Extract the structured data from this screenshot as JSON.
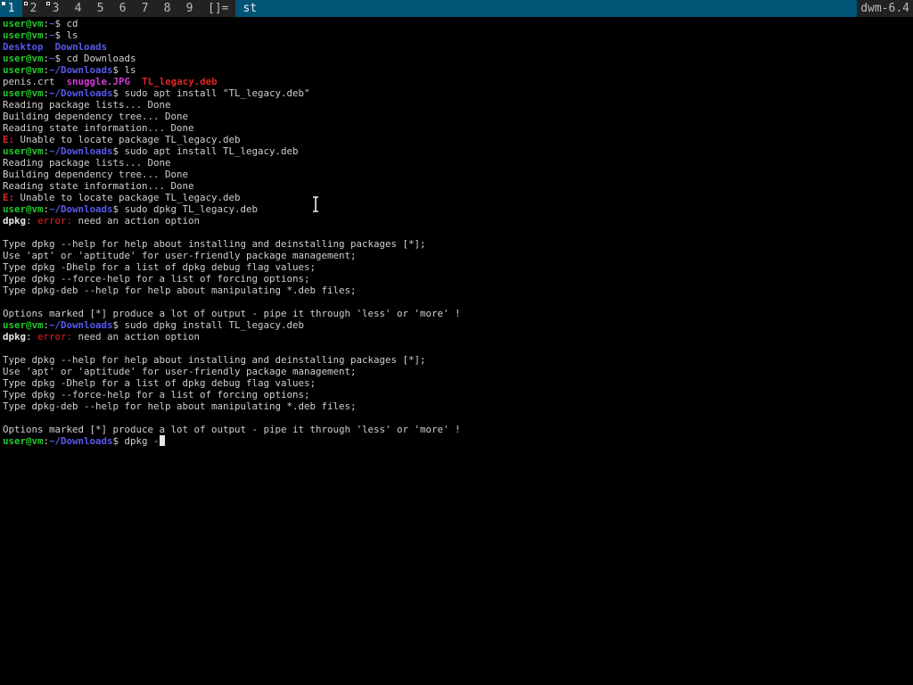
{
  "bar": {
    "tags": [
      "1",
      "2",
      "3",
      "4",
      "5",
      "6",
      "7",
      "8",
      "9"
    ],
    "selected_tag": "1",
    "layout_symbol": "[]=",
    "window_title": "st",
    "status_text": "dwm-6.4"
  },
  "terminal": {
    "prompt_user": "user@vm",
    "lines": [
      [
        {
          "t": "user@vm",
          "c": "u"
        },
        {
          "t": ":",
          "c": "w"
        },
        {
          "t": "~",
          "c": "p"
        },
        {
          "t": "$ cd",
          "c": "w"
        }
      ],
      [
        {
          "t": "user@vm",
          "c": "u"
        },
        {
          "t": ":",
          "c": "w"
        },
        {
          "t": "~",
          "c": "p"
        },
        {
          "t": "$ ls",
          "c": "w"
        }
      ],
      [
        {
          "t": "Desktop",
          "c": "dir"
        },
        {
          "t": "  ",
          "c": "w"
        },
        {
          "t": "Downloads",
          "c": "dir"
        }
      ],
      [
        {
          "t": "user@vm",
          "c": "u"
        },
        {
          "t": ":",
          "c": "w"
        },
        {
          "t": "~",
          "c": "p"
        },
        {
          "t": "$ cd Downloads",
          "c": "w"
        }
      ],
      [
        {
          "t": "user@vm",
          "c": "u"
        },
        {
          "t": ":",
          "c": "w"
        },
        {
          "t": "~/Downloads",
          "c": "p"
        },
        {
          "t": "$ ls",
          "c": "w"
        }
      ],
      [
        {
          "t": "penis.crt",
          "c": "w"
        },
        {
          "t": "  ",
          "c": "w"
        },
        {
          "t": "snuggle.JPG",
          "c": "img"
        },
        {
          "t": "  ",
          "c": "w"
        },
        {
          "t": "TL_legacy.deb",
          "c": "deb"
        }
      ],
      [
        {
          "t": "user@vm",
          "c": "u"
        },
        {
          "t": ":",
          "c": "w"
        },
        {
          "t": "~/Downloads",
          "c": "p"
        },
        {
          "t": "$ sudo apt install \"TL_legacy.deb\"",
          "c": "w"
        }
      ],
      [
        {
          "t": "Reading package lists... Done",
          "c": "w"
        }
      ],
      [
        {
          "t": "Building dependency tree... Done",
          "c": "w"
        }
      ],
      [
        {
          "t": "Reading state information... Done",
          "c": "w"
        }
      ],
      [
        {
          "t": "E:",
          "c": "err"
        },
        {
          "t": " Unable to locate package TL_legacy.deb",
          "c": "w"
        }
      ],
      [
        {
          "t": "user@vm",
          "c": "u"
        },
        {
          "t": ":",
          "c": "w"
        },
        {
          "t": "~/Downloads",
          "c": "p"
        },
        {
          "t": "$ sudo apt install TL_legacy.deb",
          "c": "w"
        }
      ],
      [
        {
          "t": "Reading package lists... Done",
          "c": "w"
        }
      ],
      [
        {
          "t": "Building dependency tree... Done",
          "c": "w"
        }
      ],
      [
        {
          "t": "Reading state information... Done",
          "c": "w"
        }
      ],
      [
        {
          "t": "E:",
          "c": "err"
        },
        {
          "t": " Unable to locate package TL_legacy.deb",
          "c": "w"
        }
      ],
      [
        {
          "t": "user@vm",
          "c": "u"
        },
        {
          "t": ":",
          "c": "w"
        },
        {
          "t": "~/Downloads",
          "c": "p"
        },
        {
          "t": "$ sudo dpkg TL_legacy.deb",
          "c": "w"
        }
      ],
      [
        {
          "t": "dpkg",
          "c": "bold"
        },
        {
          "t": ": ",
          "c": "w"
        },
        {
          "t": "error:",
          "c": "errtxt"
        },
        {
          "t": " need an action option",
          "c": "w"
        }
      ],
      [
        {
          "t": "",
          "c": "w"
        }
      ],
      [
        {
          "t": "Type dpkg --help for help about installing and deinstalling packages [*];",
          "c": "w"
        }
      ],
      [
        {
          "t": "Use 'apt' or 'aptitude' for user-friendly package management;",
          "c": "w"
        }
      ],
      [
        {
          "t": "Type dpkg -Dhelp for a list of dpkg debug flag values;",
          "c": "w"
        }
      ],
      [
        {
          "t": "Type dpkg --force-help for a list of forcing options;",
          "c": "w"
        }
      ],
      [
        {
          "t": "Type dpkg-deb --help for help about manipulating *.deb files;",
          "c": "w"
        }
      ],
      [
        {
          "t": "",
          "c": "w"
        }
      ],
      [
        {
          "t": "Options marked [*] produce a lot of output - pipe it through 'less' or 'more' !",
          "c": "w"
        }
      ],
      [
        {
          "t": "user@vm",
          "c": "u"
        },
        {
          "t": ":",
          "c": "w"
        },
        {
          "t": "~/Downloads",
          "c": "p"
        },
        {
          "t": "$ sudo dpkg install TL_legacy.deb",
          "c": "w"
        }
      ],
      [
        {
          "t": "dpkg",
          "c": "bold"
        },
        {
          "t": ": ",
          "c": "w"
        },
        {
          "t": "error:",
          "c": "errtxt"
        },
        {
          "t": " need an action option",
          "c": "w"
        }
      ],
      [
        {
          "t": "",
          "c": "w"
        }
      ],
      [
        {
          "t": "Type dpkg --help for help about installing and deinstalling packages [*];",
          "c": "w"
        }
      ],
      [
        {
          "t": "Use 'apt' or 'aptitude' for user-friendly package management;",
          "c": "w"
        }
      ],
      [
        {
          "t": "Type dpkg -Dhelp for a list of dpkg debug flag values;",
          "c": "w"
        }
      ],
      [
        {
          "t": "Type dpkg --force-help for a list of forcing options;",
          "c": "w"
        }
      ],
      [
        {
          "t": "Type dpkg-deb --help for help about manipulating *.deb files;",
          "c": "w"
        }
      ],
      [
        {
          "t": "",
          "c": "w"
        }
      ],
      [
        {
          "t": "Options marked [*] produce a lot of output - pipe it through 'less' or 'more' !",
          "c": "w"
        }
      ],
      [
        {
          "t": "user@vm",
          "c": "u"
        },
        {
          "t": ":",
          "c": "w"
        },
        {
          "t": "~/Downloads",
          "c": "p"
        },
        {
          "t": "$ dpkg -",
          "c": "w"
        }
      ]
    ],
    "current_input": "dpkg -"
  },
  "colors": {
    "bar_bg": "#222222",
    "selected_bg": "#005577",
    "prompt_user": "#22c72b",
    "prompt_path": "#5858f0",
    "error": "#e02424",
    "image_file": "#d33ad8"
  },
  "icons": {
    "mouse_cursor": "ibeam-cursor-icon",
    "text_cursor": "block-cursor"
  }
}
